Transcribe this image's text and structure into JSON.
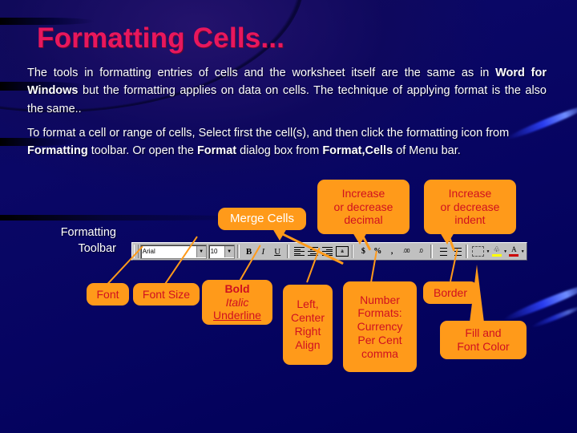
{
  "slide": {
    "title": "Formatting Cells...",
    "title_color": "#e8175d",
    "background_color": "#000066",
    "callout_fill": "#FF9A1A",
    "callout_text_color": "#D01020"
  },
  "paragraphs": {
    "p1_a": "The tools in formatting entries of cells and the worksheet itself are the same as in ",
    "p1_b": "Word for Windows",
    "p1_c": " but the formatting applies on data on cells.   The technique of applying format is the also the same..",
    "p2_a": "To format a cell or range of cells, Select first the cell(s), and then click the formatting icon from ",
    "p2_b": "Formatting",
    "p2_c": " toolbar. Or open the ",
    "p2_d": "Format",
    "p2_e": " dialog box from ",
    "p2_f": "Format,Cells",
    "p2_g": " of  Menu bar."
  },
  "toolbar": {
    "label_line1": "Formatting",
    "label_line2": "Toolbar",
    "font_name": "Arial",
    "font_size": "10",
    "bold_glyph": "B",
    "italic_glyph": "I",
    "underline_glyph": "U",
    "currency_glyph": "$",
    "percent_glyph": "%",
    "comma_glyph": ",",
    "inc_decimal_glyph": ".00",
    "dec_decimal_glyph": ".0",
    "fill_color_glyph": "A",
    "font_color_glyph": "A",
    "fill_bar_color": "#FFFF00",
    "font_bar_color": "#CC0000",
    "dropdown_arrow": "▼"
  },
  "callouts": {
    "merge_cells": {
      "lines": [
        "Merge Cells"
      ]
    },
    "increase_decimal": {
      "lines": [
        "Increase",
        "or decrease",
        "decimal"
      ]
    },
    "increase_indent": {
      "lines": [
        "Increase",
        "or decrease",
        "indent"
      ]
    },
    "font": {
      "lines": [
        "Font"
      ]
    },
    "font_size": {
      "lines": [
        "Font Size"
      ]
    },
    "bold_italic_underline": {
      "lines": [
        "Bold",
        "Italic",
        "Underline"
      ]
    },
    "align": {
      "lines": [
        "Left,",
        "Center",
        "Right",
        "Align"
      ]
    },
    "number_formats": {
      "lines": [
        "Number",
        "Formats:",
        "Currency",
        "Per Cent",
        "comma"
      ]
    },
    "border": {
      "lines": [
        "Border"
      ]
    },
    "fill_font_color": {
      "lines": [
        "Fill and",
        "Font Color"
      ]
    }
  }
}
